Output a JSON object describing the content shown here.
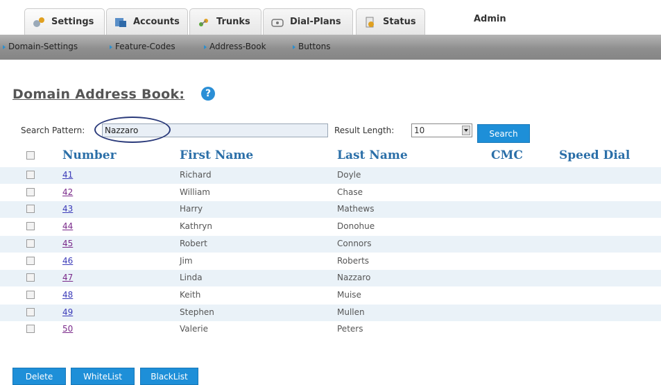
{
  "tabs": [
    {
      "label": "Settings",
      "icon": "settings-icon"
    },
    {
      "label": "Accounts",
      "icon": "accounts-icon"
    },
    {
      "label": "Trunks",
      "icon": "trunks-icon"
    },
    {
      "label": "Dial-Plans",
      "icon": "dial-plans-icon"
    },
    {
      "label": "Status",
      "icon": "status-icon"
    }
  ],
  "admin_label": "Admin",
  "subnav": [
    "Domain-Settings",
    "Feature-Codes",
    "Address-Book",
    "Buttons"
  ],
  "page_title": "Domain Address Book:",
  "help_glyph": "?",
  "search": {
    "label": "Search Pattern:",
    "value": "Nazzaro",
    "result_label": "Result Length:",
    "result_value": "10",
    "button": "Search"
  },
  "table": {
    "headers": [
      "Number",
      "First Name",
      "Last Name",
      "CMC",
      "Speed Dial"
    ],
    "rows": [
      {
        "number": "41",
        "first": "Richard",
        "last": "Doyle"
      },
      {
        "number": "42",
        "first": "William",
        "last": "Chase"
      },
      {
        "number": "43",
        "first": "Harry",
        "last": "Mathews"
      },
      {
        "number": "44",
        "first": "Kathryn",
        "last": "Donohue"
      },
      {
        "number": "45",
        "first": "Robert",
        "last": "Connors"
      },
      {
        "number": "46",
        "first": "Jim",
        "last": "Roberts"
      },
      {
        "number": "47",
        "first": "Linda",
        "last": "Nazzaro"
      },
      {
        "number": "48",
        "first": "Keith",
        "last": "Muise"
      },
      {
        "number": "49",
        "first": "Stephen",
        "last": "Mullen"
      },
      {
        "number": "50",
        "first": "Valerie",
        "last": "Peters"
      }
    ]
  },
  "actions": [
    "Delete",
    "WhiteList",
    "BlackList"
  ],
  "colors": {
    "accent": "#1e8fd8",
    "header_text": "#2b6fa8",
    "row_alt": "#eaf2f8"
  }
}
